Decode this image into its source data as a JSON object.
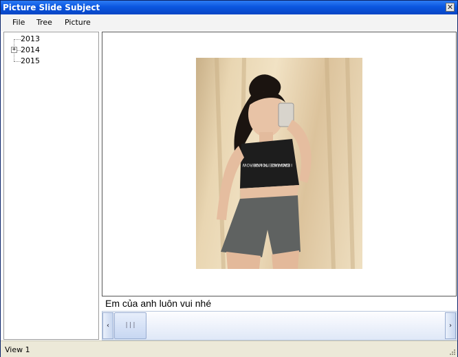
{
  "window": {
    "title": "Picture Slide Subject",
    "close_glyph": "✕"
  },
  "menu": {
    "items": [
      "File",
      "Tree",
      "Picture"
    ]
  },
  "tree": {
    "nodes": [
      {
        "label": "2013",
        "expandable": false
      },
      {
        "label": "2014",
        "expandable": true,
        "expander_glyph": "+"
      },
      {
        "label": "2015",
        "expandable": false
      }
    ]
  },
  "viewer": {
    "image": "photo of a girl in a black crop top and grey shorts taking a mirror selfie",
    "shirt_text_line1": "BECAUSE I'M LIVE",
    "shirt_text_line2": "I CAN FACE TOMORROW"
  },
  "caption": "Em của anh luôn vui nhé",
  "scrollbar": {
    "left_arrow": "‹",
    "right_arrow": "›",
    "thumb_grip": "|||",
    "position": 0
  },
  "status": {
    "text": "View 1"
  },
  "colors": {
    "title_bar": "#0a56e0",
    "status_bar": "#ece9d8"
  }
}
